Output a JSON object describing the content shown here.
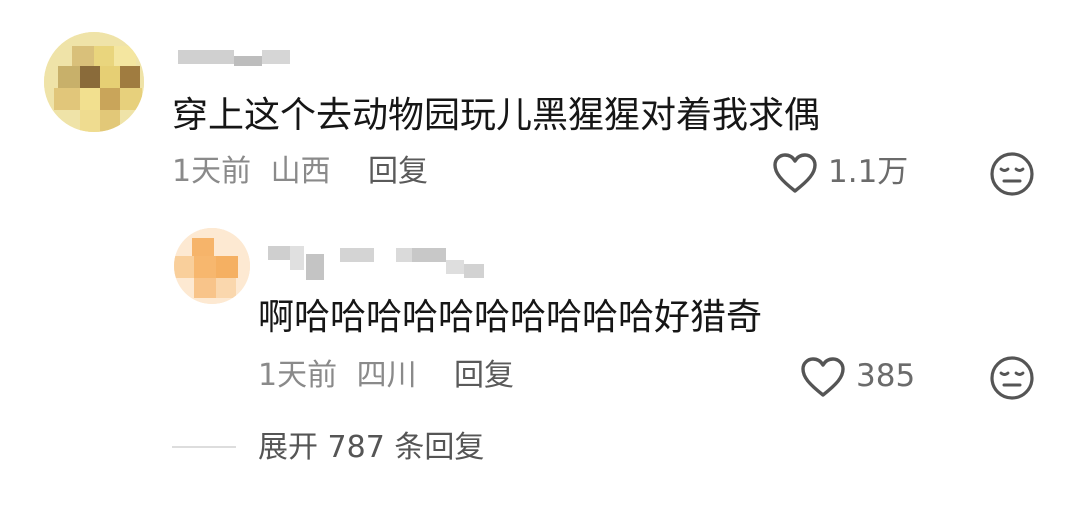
{
  "comment": {
    "text": "穿上这个去动物园玩儿黑猩猩对着我求偶",
    "time": "1天前",
    "location": "山西",
    "reply_label": "回复",
    "likes": "1.1万"
  },
  "reply": {
    "text": "啊哈哈哈哈哈哈哈哈哈哈好猎奇",
    "time": "1天前",
    "location": "四川",
    "reply_label": "回复",
    "likes": "385"
  },
  "expand": {
    "label": "展开 787 条回复"
  },
  "icons": {
    "like": "heart-icon",
    "reaction": "neutral-face-icon"
  }
}
